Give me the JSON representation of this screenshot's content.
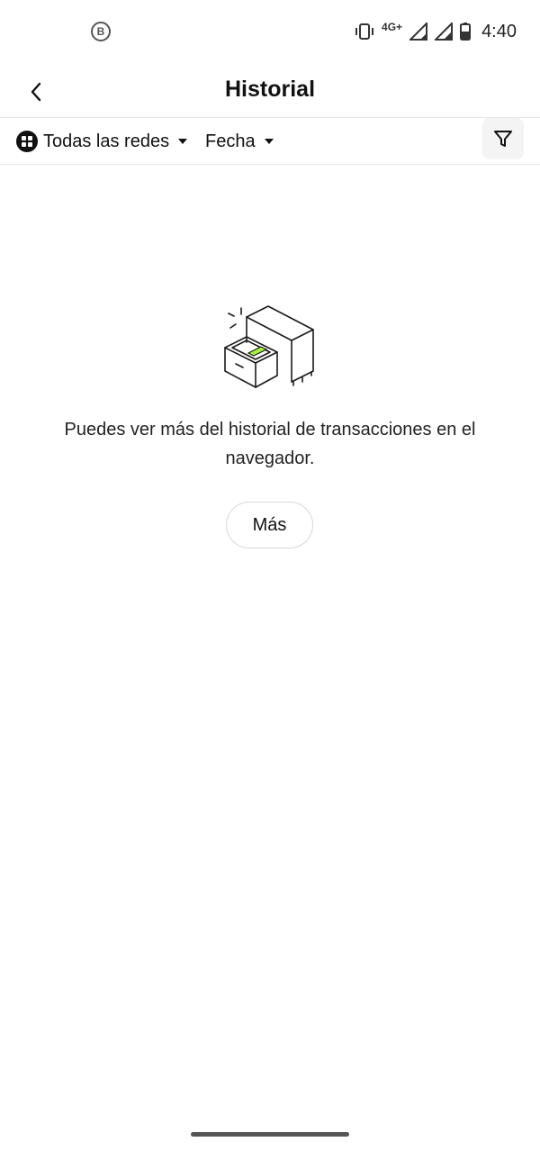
{
  "status_bar": {
    "left_icon_letter": "B",
    "network": "4G+",
    "time": "4:40",
    "icons": [
      "vibrate-icon",
      "signal-icon",
      "signal-icon",
      "battery-icon"
    ]
  },
  "header": {
    "title": "Historial",
    "back_icon": "chevron-left-icon"
  },
  "filters": {
    "networks_label": "Todas las redes",
    "date_label": "Fecha",
    "filter_icon": "funnel-icon"
  },
  "empty_state": {
    "illustration": "open-drawer-cabinet",
    "accent_color": "#a6f33d",
    "message": "Puedes ver más del historial de transacciones en el navegador.",
    "button_label": "Más"
  }
}
